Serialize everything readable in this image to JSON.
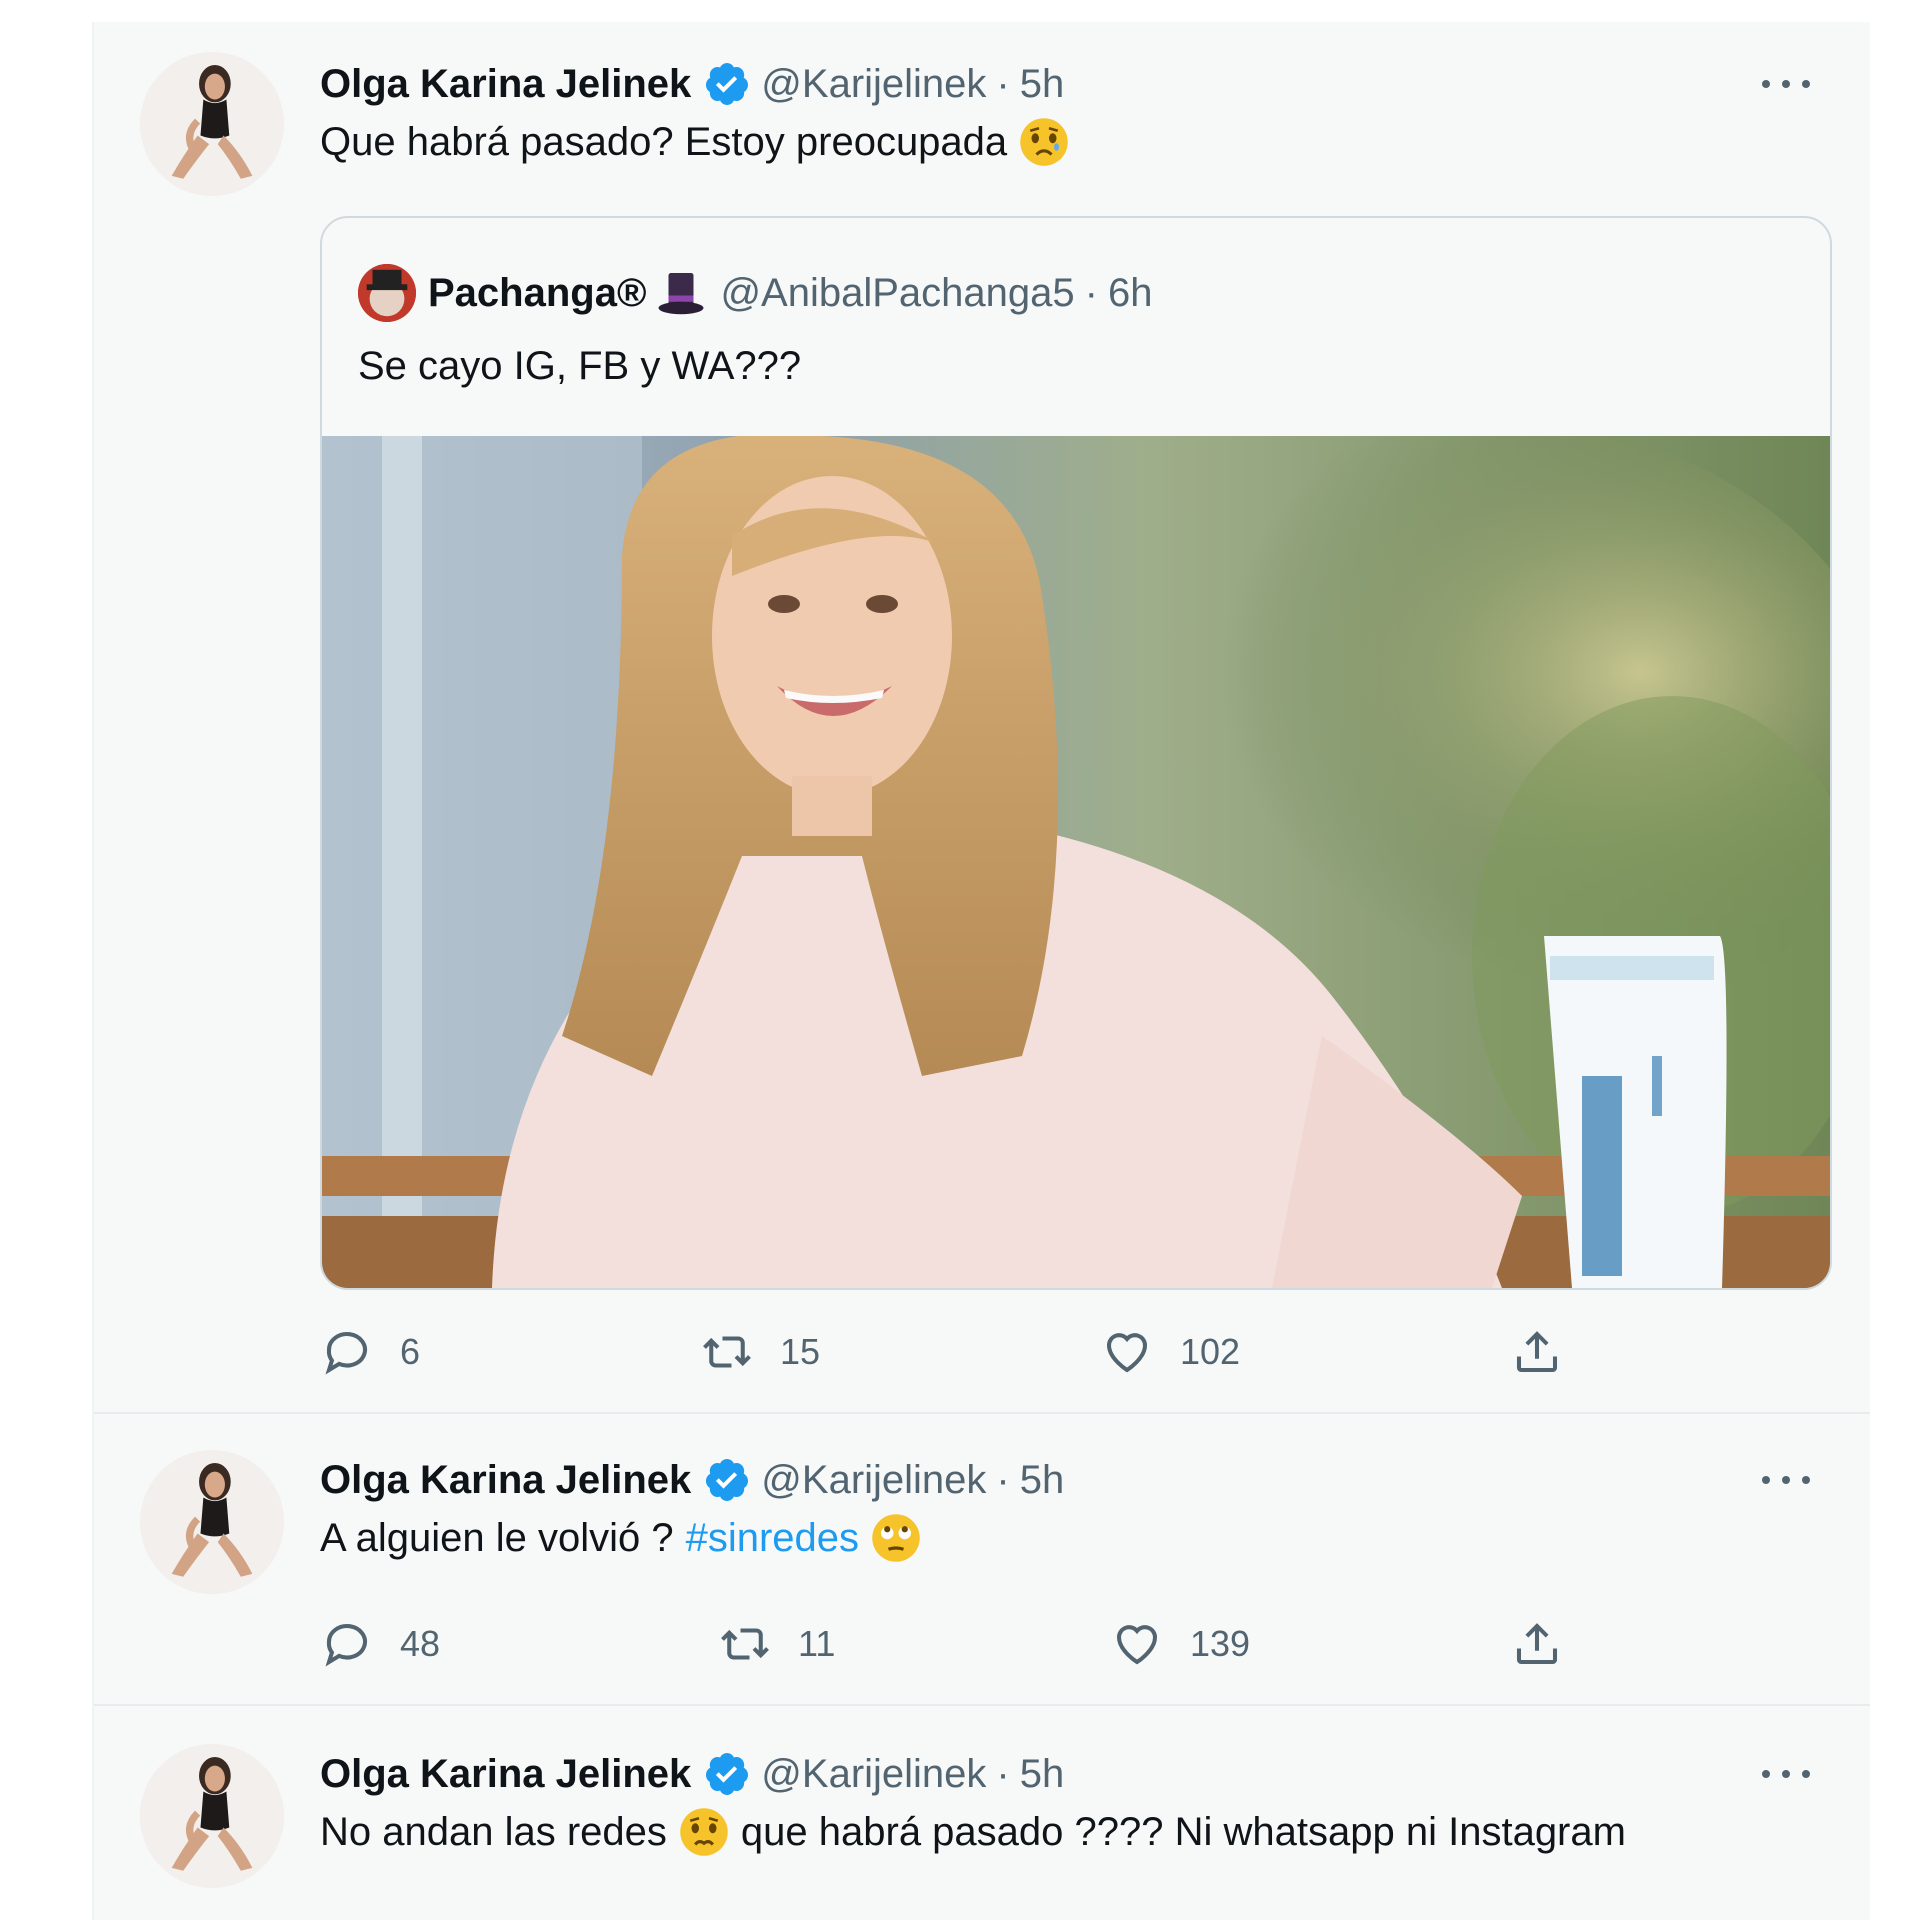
{
  "tweets": [
    {
      "name": "Olga Karina Jelinek",
      "handle": "@Karijelinek",
      "separator": "·",
      "time": "5h",
      "text": "Que habrá pasado? Estoy preocupada",
      "emoji": "worried-face",
      "quoted": {
        "name": "Pachanga®",
        "emoji": "top-hat",
        "handle": "@AnibalPachanga5",
        "separator": "·",
        "time": "6h",
        "text": "Se cayo IG, FB y WA???"
      },
      "counts": {
        "replies": "6",
        "retweets": "15",
        "likes": "102"
      }
    },
    {
      "name": "Olga Karina Jelinek",
      "handle": "@Karijelinek",
      "separator": "·",
      "time": "5h",
      "text": "A alguien le volvió ?",
      "hashtag": "#sinredes",
      "emoji": "face-with-rolling-eyes",
      "counts": {
        "replies": "48",
        "retweets": "11",
        "likes": "139"
      }
    },
    {
      "name": "Olga Karina Jelinek",
      "handle": "@Karijelinek",
      "separator": "·",
      "time": "5h",
      "text_before": "No andan las redes",
      "text_after": "que habrá pasado ???? Ni whatsapp ni Instagram",
      "emoji": "worried-face"
    }
  ],
  "colors": {
    "accent": "#1d9bf0",
    "text": "#0f1419",
    "secondary": "#536471",
    "background": "#f7f9f9",
    "border": "#cfd9de"
  },
  "icons": [
    "verified-badge-icon",
    "more-icon",
    "reply-icon",
    "retweet-icon",
    "like-icon",
    "share-icon"
  ]
}
